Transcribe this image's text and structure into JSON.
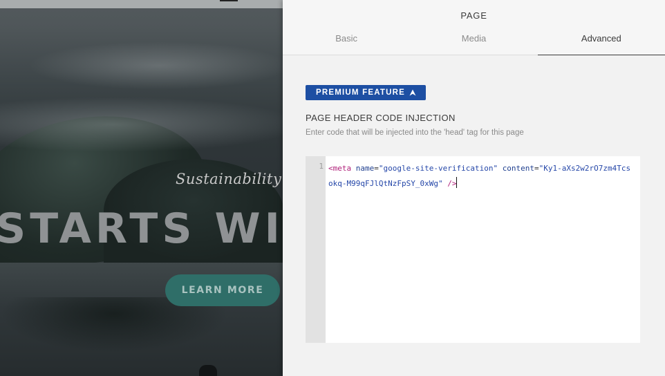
{
  "preview": {
    "tagline": "Sustainability",
    "headline": "STARTS WIT",
    "cta_label": "LEARN MORE"
  },
  "panel": {
    "title": "PAGE",
    "tabs": [
      {
        "label": "Basic",
        "active": false
      },
      {
        "label": "Media",
        "active": false
      },
      {
        "label": "Advanced",
        "active": true
      }
    ],
    "premium_badge": "PREMIUM FEATURE",
    "section_label": "PAGE HEADER CODE INJECTION",
    "section_description": "Enter code that will be injected into the 'head' tag for this page",
    "editor": {
      "line_number": "1",
      "code": {
        "open": "<meta",
        "attr1_name": "name",
        "attr1_value": "\"google-site-verification\"",
        "attr2_name": "content",
        "attr2_value": "\"Ky1-aXs2w2rO7zm4Tcsokq-M99qFJlQtNzFpSY_0xWg\"",
        "close": "/>"
      }
    }
  },
  "colors": {
    "premium_badge": "#1d4fa3",
    "cta_button": "#2f6e68",
    "panel_background": "#f2f2f2",
    "code_tag": "#b0207a",
    "code_string": "#2446a8"
  }
}
